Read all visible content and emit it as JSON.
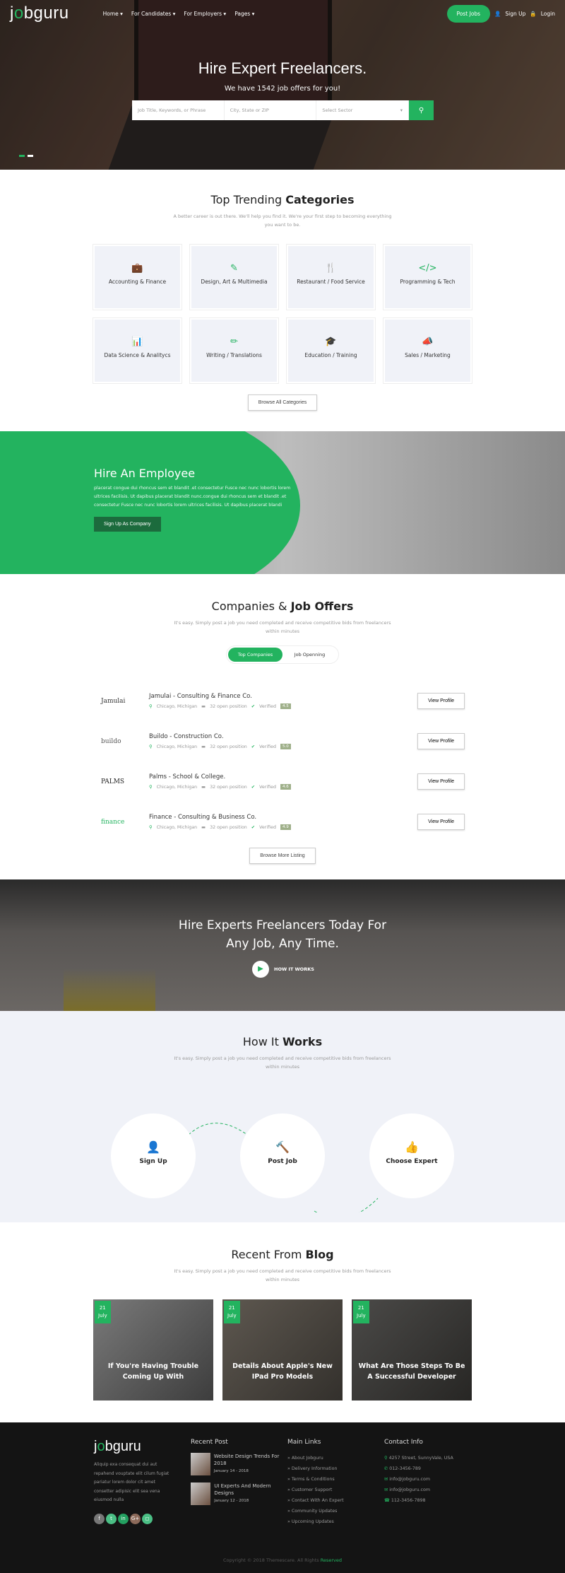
{
  "brand": {
    "logo_pre": "j",
    "logo_o": "o",
    "logo_post": "bguru",
    "accent": "#23b35f"
  },
  "nav": {
    "items": [
      "Home",
      "For Candidates",
      "For Employers",
      "Pages"
    ],
    "post_jobs": "Post Jobs",
    "sign_up": "Sign Up",
    "login": "Login"
  },
  "hero": {
    "title": "Hire Expert Freelancers.",
    "subtitle": "We have 1542 job offers for you!",
    "search": {
      "keyword_placeholder": "Job Title, Keywords, or Phrase",
      "location_placeholder": "City, State or ZIP",
      "sector_selected": "Select Sector"
    }
  },
  "categories": {
    "title_a": "Top Trending ",
    "title_b": "Categories",
    "subtitle": "A better career is out there. We'll help you find it. We're your first step to becoming everything you want to be.",
    "items": [
      {
        "icon": "briefcase-icon",
        "glyph": "💼",
        "label": "Accounting & Finance"
      },
      {
        "icon": "edit-icon",
        "glyph": "✎",
        "label": "Design, Art & Multimedia"
      },
      {
        "icon": "cutlery-icon",
        "glyph": "🍴",
        "label": "Restaurant / Food Service"
      },
      {
        "icon": "code-icon",
        "glyph": "</>",
        "label": "Programming & Tech"
      },
      {
        "icon": "bar-chart-icon",
        "glyph": "📊",
        "label": "Data Science & Analitycs"
      },
      {
        "icon": "pencil-icon",
        "glyph": "✏",
        "label": "Writing / Translations"
      },
      {
        "icon": "graduation-cap-icon",
        "glyph": "🎓",
        "label": "Education / Training"
      },
      {
        "icon": "bullhorn-icon",
        "glyph": "📣",
        "label": "Sales / Marketing"
      }
    ],
    "browse": "Browse All Categories"
  },
  "hire": {
    "title": "Hire An Employee",
    "text": "placerat congue dui rhoncus sem et blandit .et consectetur Fusce nec nunc lobortis lorem ultrices facilisis. Ut dapibus placerat blandit nunc.congue dui rhoncus sem et blandit .et consectetur Fusce nec nunc lobortis lorem ultrices facilisis. Ut dapibus placerat blandi",
    "button": "Sign Up As Company"
  },
  "companies": {
    "title_a": "Companies & ",
    "title_b": "Job Offers",
    "subtitle": "It's easy. Simply post a job you need completed and receive competitive bids from freelancers within minutes",
    "tabs": [
      "Top Companies",
      "Job Openning"
    ],
    "list": [
      {
        "logo": "Jamulai",
        "name": "Jamulai - Consulting & Finance Co.",
        "location": "Chicago, Michigan",
        "positions": "32 open position",
        "verified": "Verified",
        "rating": "4.5"
      },
      {
        "logo": "buildo",
        "name": "Buildo - Construction Co.",
        "location": "Chicago, Michigan",
        "positions": "32 open position",
        "verified": "Verified",
        "rating": "5.0"
      },
      {
        "logo": "PALMS",
        "name": "Palms - School & College.",
        "location": "Chicago, Michigan",
        "positions": "32 open position",
        "verified": "Verified",
        "rating": "4.6"
      },
      {
        "logo": "finance",
        "name": "Finance - Consulting & Business Co.",
        "location": "Chicago, Michigan",
        "positions": "32 open position",
        "verified": "Verified",
        "rating": "4.9"
      }
    ],
    "view_profile": "View Profile",
    "browse": "Browse More Listing"
  },
  "banner": {
    "line1": "Hire Experts Freelancers Today For",
    "line2": "Any Job, Any Time.",
    "cta": "HOW IT WORKS"
  },
  "how": {
    "title_a": "How It ",
    "title_b": "Works",
    "subtitle": "It's easy. Simply post a job you need completed and receive competitive bids from freelancers within minutes",
    "steps": [
      {
        "icon": "user-icon",
        "glyph": "👤",
        "label": "Sign Up"
      },
      {
        "icon": "gavel-icon",
        "glyph": "🔨",
        "label": "Post Job"
      },
      {
        "icon": "thumbs-up-icon",
        "glyph": "👍",
        "label": "Choose Expert"
      }
    ]
  },
  "blog": {
    "title_a": "Recent From ",
    "title_b": "Blog",
    "subtitle": "It's easy. Simply post a job you need completed and receive competitive bids from freelancers within minutes",
    "posts": [
      {
        "day": "21",
        "month": "July",
        "title": "If You're Having Trouble Coming Up With"
      },
      {
        "day": "21",
        "month": "July",
        "title": "Details About Apple's New IPad Pro Models"
      },
      {
        "day": "21",
        "month": "July",
        "title": "What Are Those Steps To Be A Successful Developer"
      }
    ]
  },
  "footer": {
    "about": "Aliquip exa consequat dui aut repahend vouptate elit cilum fugiat pariatur lorem dolor cit amet consetter adipisic elit sea vena eiusmod nulla",
    "social": [
      "f",
      "t",
      "in",
      "G+",
      "◻"
    ],
    "recent_title": "Recent Post",
    "recent": [
      {
        "title": "Website Design Trends For 2018",
        "date": "January 14 - 2018"
      },
      {
        "title": "UI Experts And Modern Designs",
        "date": "January 12 - 2018"
      }
    ],
    "links_title": "Main Links",
    "links": [
      "About Jobguru",
      "Delivery Information",
      "Terms & Conditions",
      "Customer Support",
      "Contact With An Expert",
      "Community Updates",
      "Upcoming Updates"
    ],
    "contact_title": "Contact Info",
    "contact": [
      "4257 Street, SunnyVale, USA",
      "012-3456-789",
      "info@jobguru.com",
      "info@jobguru.com",
      "112-3456-7898"
    ],
    "copyright": "Copyright © 2018 Themescare. All Rights ",
    "reserved": "Reserved"
  }
}
